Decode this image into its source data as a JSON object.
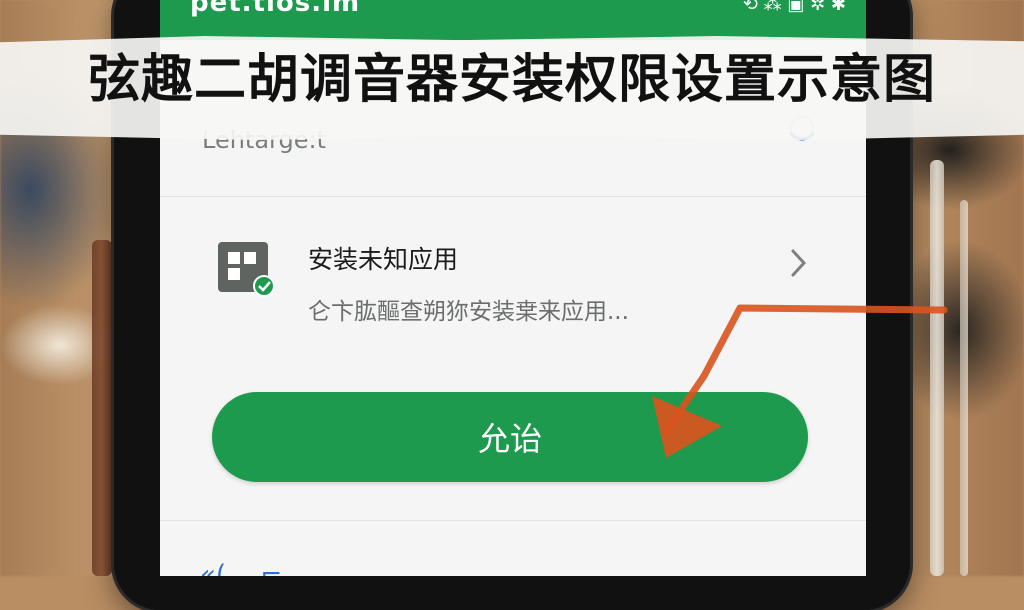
{
  "banner": {
    "title": "弦趣二胡调音器安装权限设置示意图"
  },
  "status_bar": {
    "partial_text": "pet.tios.im",
    "icons": "⟲ ⁂ ▣ ✲ ✱"
  },
  "header": {
    "label": "Lehtarge:t",
    "icon": "headset-icon"
  },
  "setting_row": {
    "title": "安装未知应用",
    "subtitle": "仑卞肱醧查朔狝安装枽来应用...",
    "icon": "app-install-icon"
  },
  "allow_button": {
    "label": "允诒"
  },
  "bottom_partial": {
    "text": "«(… ⌐"
  },
  "colors": {
    "accent": "#1d9a4e",
    "arrow": "#d9541e",
    "screen_bg": "#f4f5f4"
  }
}
